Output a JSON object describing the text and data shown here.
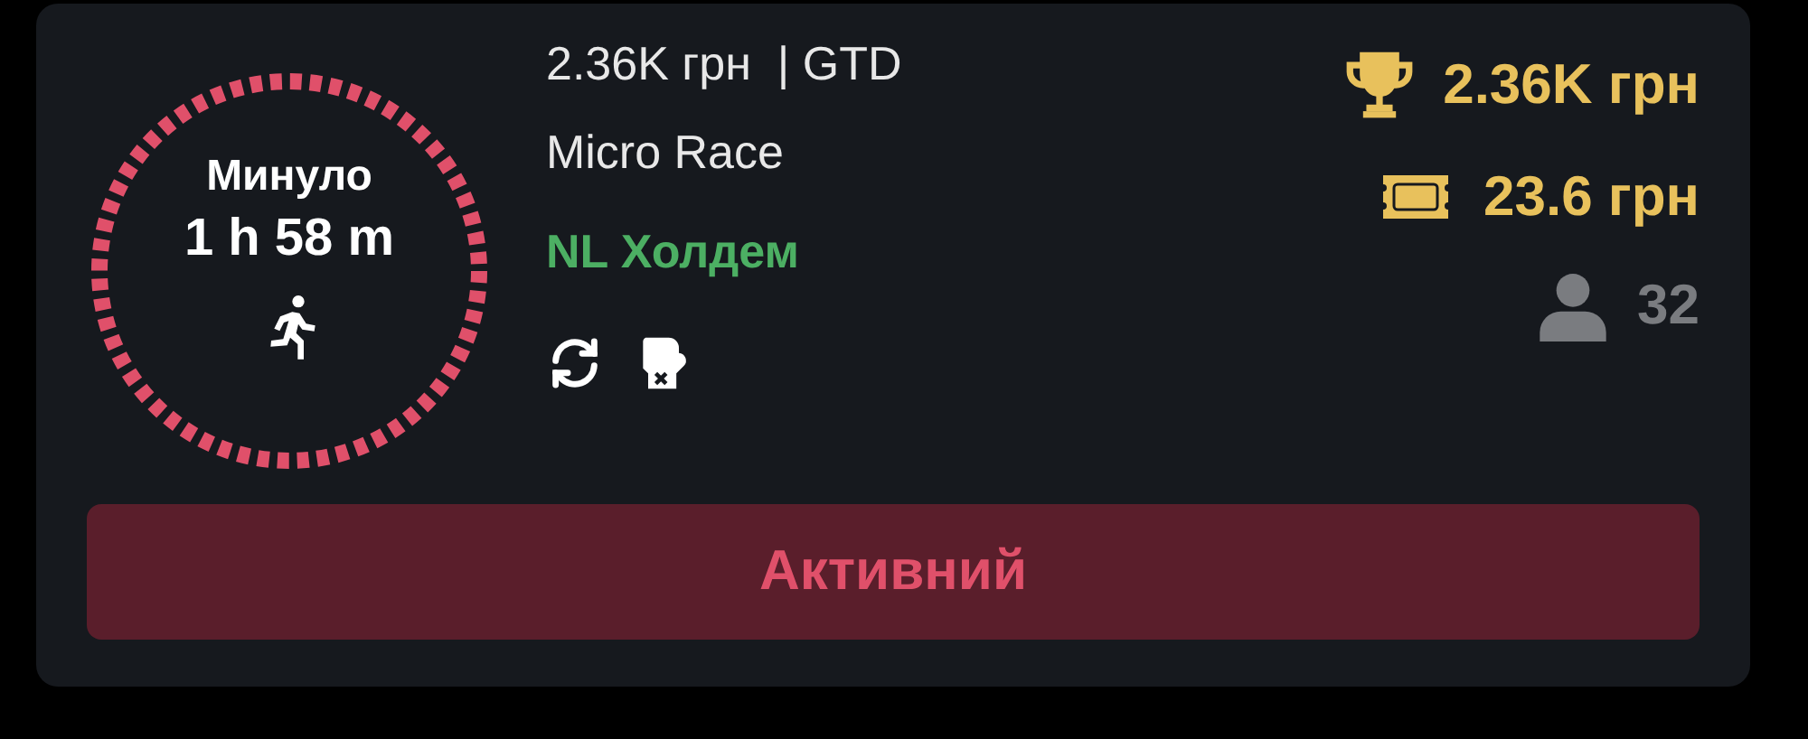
{
  "timer": {
    "label": "Минуло",
    "elapsed": "1 h 58 m"
  },
  "info": {
    "guarantee": "2.36K грн  | GTD",
    "name": "Micro Race",
    "game": "NL Холдем"
  },
  "stats": {
    "prize": "2.36K грн",
    "buy_in": "23.6 грн",
    "players": "32"
  },
  "status_button": "Активний"
}
